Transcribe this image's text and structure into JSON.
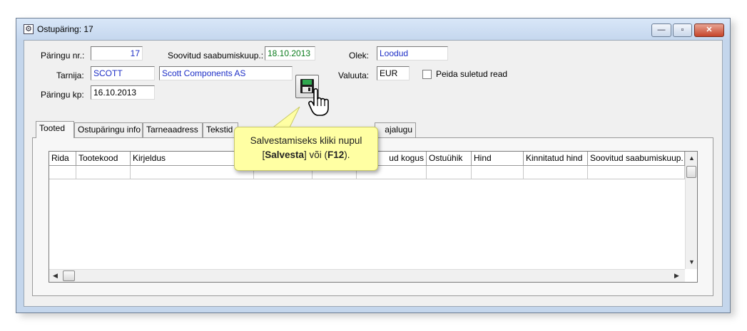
{
  "window": {
    "title": "Ostupäring: 17",
    "controls": {
      "minimize": "—",
      "maximize": "▫",
      "close": "✕"
    }
  },
  "form": {
    "paringu_nr": {
      "label": "Päringu nr.:",
      "value": "17"
    },
    "soovitud_saabumiskuup": {
      "label": "Soovitud saabumiskuup.:",
      "value": "18.10.2013"
    },
    "olek": {
      "label": "Olek:",
      "value": "Loodud"
    },
    "tarnija": {
      "label": "Tarnija:",
      "code": "SCOTT",
      "name": "Scott Components AS"
    },
    "valuuta": {
      "label": "Valuuta:",
      "value": "EUR"
    },
    "peida_suletud_read": {
      "label": "Peida suletud read",
      "checked": false
    },
    "paringu_kp": {
      "label": "Päringu kp:",
      "value": "16.10.2013"
    }
  },
  "tabs": [
    "Tooted",
    "Ostupäringu info",
    "Tarneaadress",
    "Tekstid",
    "ajalugu"
  ],
  "active_tab": "Tooted",
  "grid": {
    "columns": [
      "Rida",
      "Tootekood",
      "Kirjeldus",
      "",
      "",
      "ud kogus",
      "Ostuühik",
      "Hind",
      "Kinnitatud hind",
      "Soovitud saabumiskuup."
    ]
  },
  "save_button": {
    "icon": "floppy-disk-icon"
  },
  "callout": {
    "line1": "Salvestamiseks kliki nupul",
    "open_bracket": "[",
    "salvesta": "Salvesta",
    "mid": "] või (",
    "f12": "F12",
    "end": ")."
  },
  "colors": {
    "field_value_blue": "#1d2ec6",
    "date_green": "#0a7b1c",
    "callout_bg": "#ffffa3",
    "window_frame": "#c4d6ec"
  }
}
